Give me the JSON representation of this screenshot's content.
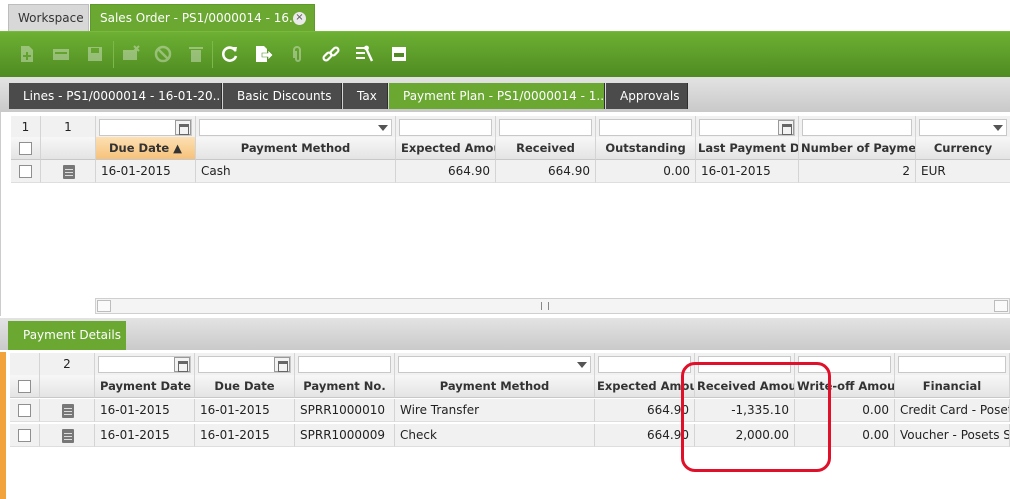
{
  "window_tabs": [
    {
      "label": "Workspace"
    },
    {
      "label": "Sales Order - PS1/0000014 - 16..."
    }
  ],
  "toolbar_icons": [
    "new-document-icon",
    "new-row-icon",
    "save-icon",
    "delete-row-icon",
    "undo-icon",
    "trash-icon",
    "refresh-icon",
    "export-icon",
    "attachment-icon",
    "link-icon",
    "tools-icon",
    "grid-view-icon"
  ],
  "subtabs": [
    {
      "label": "Lines - PS1/0000014 - 16-01-20..."
    },
    {
      "label": "Basic Discounts"
    },
    {
      "label": "Tax"
    },
    {
      "label": "Payment Plan - PS1/0000014 - 1..."
    },
    {
      "label": "Approvals"
    }
  ],
  "payment_plan": {
    "filter_counts": [
      "1",
      "1"
    ],
    "columns": [
      "Due Date",
      "Payment Method",
      "Expected Amount",
      "Received",
      "Outstanding",
      "Last Payment Date",
      "Number of Payments",
      "Currency"
    ],
    "sort_indicator": "▲",
    "rows": [
      {
        "due_date": "16-01-2015",
        "payment_method": "Cash",
        "expected_amount": "664.90",
        "received": "664.90",
        "outstanding": "0.00",
        "last_payment_date": "16-01-2015",
        "number_of_payments": "2",
        "currency": "EUR"
      }
    ]
  },
  "payment_details": {
    "tab_label": "Payment Details",
    "filter_count": "2",
    "columns": [
      "Payment Date",
      "Due Date",
      "Payment No.",
      "Payment Method",
      "Expected Amount",
      "Received Amount",
      "Write-off Amount",
      "Financial"
    ],
    "rows": [
      {
        "payment_date": "16-01-2015",
        "due_date": "16-01-2015",
        "payment_no": "SPRR1000010",
        "payment_method": "Wire Transfer",
        "expected_amount": "664.90",
        "received_amount": "-1,335.10",
        "writeoff_amount": "0.00",
        "financial": "Credit Card - Posets"
      },
      {
        "payment_date": "16-01-2015",
        "due_date": "16-01-2015",
        "payment_no": "SPRR1000009",
        "payment_method": "Check",
        "expected_amount": "664.90",
        "received_amount": "2,000.00",
        "writeoff_amount": "0.00",
        "financial": "Voucher - Posets St"
      }
    ]
  },
  "colors": {
    "accent_green": "#6aa832",
    "dark_tab": "#4b4b4b",
    "sort_header": "#f6c27a",
    "highlight_red": "#e0102a",
    "side_bar_orange": "#f3a33c"
  }
}
